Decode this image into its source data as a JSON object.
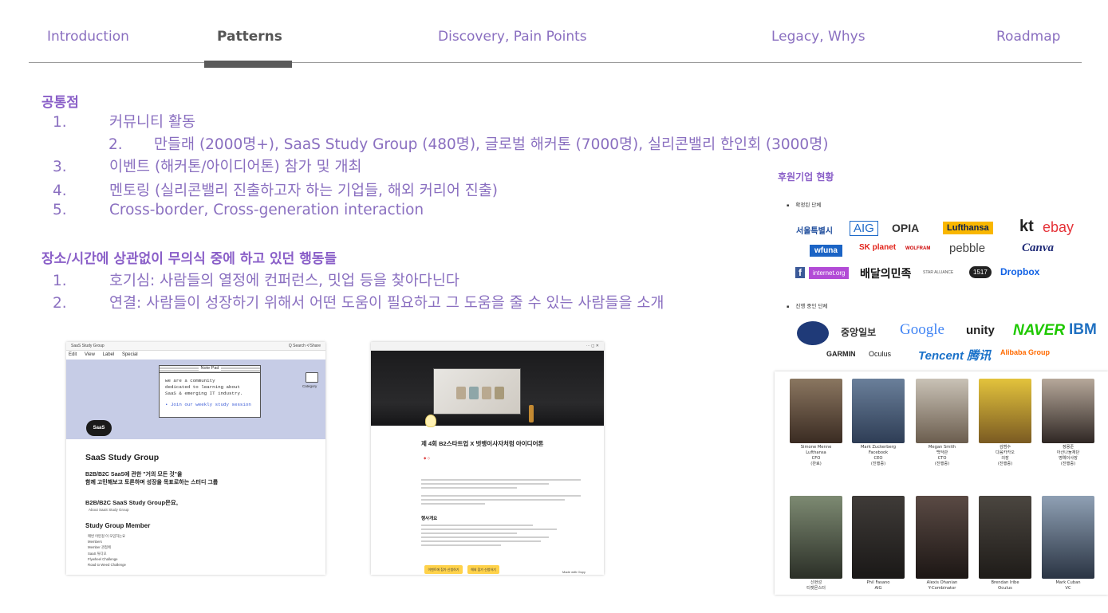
{
  "nav": {
    "tabs": [
      {
        "label": "Introduction"
      },
      {
        "label": "Patterns"
      },
      {
        "label": "Discovery, Pain Points"
      },
      {
        "label": "Legacy, Whys"
      },
      {
        "label": "Roadmap"
      }
    ],
    "active": "Patterns"
  },
  "section1": {
    "heading": "공통점",
    "items": [
      {
        "num": "1.",
        "text": "커뮤니티 활동"
      },
      {
        "num": "2.",
        "text": "만들래 (2000명+), SaaS Study Group (480명), 글로벌 해커톤 (7000명), 실리콘밸리 한인회 (3000명)"
      },
      {
        "num": "3.",
        "text": "이벤트 (해커톤/아이디어톤) 참가 및 개최"
      },
      {
        "num": "4.",
        "text": "멘토링 (실리콘밸리 진출하고자 하는 기업들, 해외 커리어 진출)"
      },
      {
        "num": "5.",
        "text": "Cross-border, Cross-generation interaction"
      }
    ]
  },
  "section2": {
    "heading": "장소/시간에 상관없이 무의식 중에 하고 있던 행동들",
    "items": [
      {
        "num": "1.",
        "text": "호기심: 사람들의 열정에 컨퍼런스, 밋업 등을 찾아다닌다"
      },
      {
        "num": "2.",
        "text": "연결: 사람들이 성장하기 위해서 어떤 도움이 필요하고 그 도움을 줄 수 있는 사람들을 소개"
      }
    ]
  },
  "saas_card": {
    "window_title": "SaaS Study Group",
    "window_actions": "Q Search  ≮ Share",
    "menu": [
      "Edit",
      "View",
      "Label",
      "Special"
    ],
    "notepad_title": "Note Pad",
    "notepad_lines": [
      "we are a community",
      "dedicated to learning about",
      "SaaS & emerging IT industry."
    ],
    "notepad_link": "• Join our weekly study session",
    "folder_label": "Category",
    "logo_text": "SaaS",
    "title": "SaaS Study Group",
    "tagline_1": "B2B/B2C SaaS에 관한 \"거의 모든 것\"을",
    "tagline_2": "함께 고민해보고 토론하며 성장을 목표로하는 스터디 그룹",
    "about_heading": "B2B/B2C SaaS Study Group은요,",
    "about_link": "About SaaS Study Group",
    "members_heading": "Study Group Member",
    "members_list": [
      "매번 어떤걸 이 모임하는요",
      "Members",
      "Member 관점에",
      "SaaS 튜디오",
      "Flywheel Challenge",
      "Road to Weed Challenge"
    ]
  },
  "idea_card": {
    "title": "제 4회 B2스타트업 X 벗뱅이사자처럼 아이디어톤",
    "section": "행사개요",
    "button_1": "이벤트에 참가 신청하기",
    "button_2": "해외 참가 신청하기",
    "made_with": "Made with Oopy"
  },
  "sponsor_card": {
    "title": "후원기업 현황",
    "confirmed_label": "확정된 단체",
    "progress_label": "진행 중인 단체",
    "confirmed_logos": [
      "서울특별시",
      "AIG",
      "OPIA",
      "Lufthansa",
      "kt",
      "ebay",
      "wfuna",
      "SK planet",
      "WOLFRAM",
      "pebble",
      "Canva",
      "f",
      "internet.org",
      "배달의민족",
      "STAR ALLIANCE",
      "1517",
      "Dropbox"
    ],
    "progress_logos": [
      "중앙일보",
      "Google",
      "unity",
      "NAVER",
      "IBM",
      "GARMIN",
      "Oculus",
      "Tencent 腾讯",
      "Alibaba Group"
    ]
  },
  "people": [
    {
      "name": "Simone Menne",
      "line2": "Lufthansa",
      "line3": "CFO",
      "line4": "(완료)"
    },
    {
      "name": "Mark Zuckerberg",
      "line2": "Facebook",
      "line3": "CEO",
      "line4": "(진행중)"
    },
    {
      "name": "Megan Smith",
      "line2": "백악관",
      "line3": "CTO",
      "line4": "(진행중)"
    },
    {
      "name": "김범수",
      "line2": "다음카카오",
      "line3": "의장",
      "line4": "(진행중)"
    },
    {
      "name": "정몽준",
      "line2": "아산나눔재단",
      "line3": "명예이사장",
      "line4": "(진행중)"
    },
    {
      "name": "신현성",
      "line2": "티켓몬스터",
      "line3": "",
      "line4": ""
    },
    {
      "name": "Phil Fasano",
      "line2": "AIG",
      "line3": "",
      "line4": ""
    },
    {
      "name": "Alexis Ohanian",
      "line2": "Y-Combinator",
      "line3": "",
      "line4": ""
    },
    {
      "name": "Brendan Iribe",
      "line2": "Oculus",
      "line3": "",
      "line4": ""
    },
    {
      "name": "Mark Cuban",
      "line2": "VC",
      "line3": "",
      "line4": ""
    }
  ]
}
